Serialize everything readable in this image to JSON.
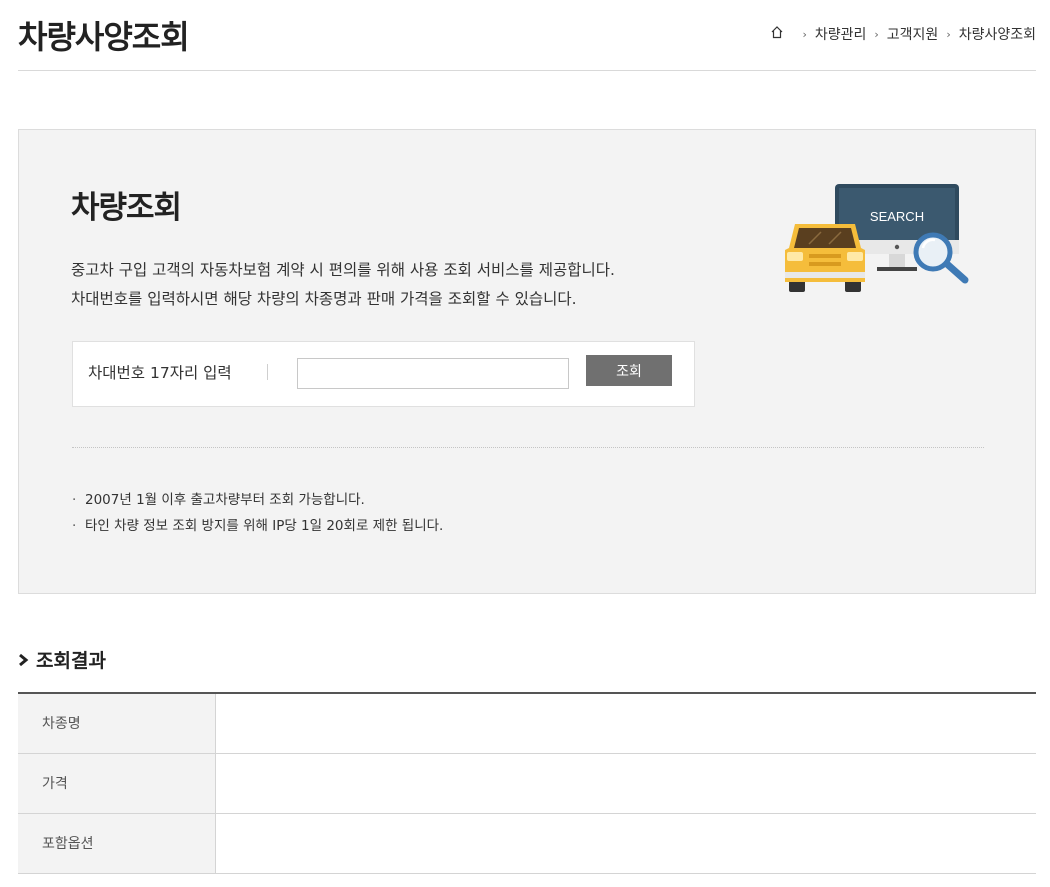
{
  "page": {
    "title": "차량사양조회"
  },
  "breadcrumb": {
    "home_icon": "home-icon",
    "items": [
      "차량관리",
      "고객지원",
      "차량사양조회"
    ]
  },
  "search_panel": {
    "title": "차량조회",
    "description": [
      "중고차 구입 고객의 자동차보험 계약 시 편의를 위해 사용 조회 서비스를 제공합니다.",
      "차대번호를 입력하시면 해당 차량의 차종명과 판매 가격을 조회할 수 있습니다."
    ],
    "illustration": {
      "monitor_text": "SEARCH",
      "icons": [
        "car-icon",
        "monitor-icon",
        "magnifier-icon"
      ]
    },
    "form": {
      "label": "차대번호 17자리 입력",
      "input_value": "",
      "input_placeholder": "",
      "button_label": "조회"
    },
    "notes": [
      "2007년 1월 이후 출고차량부터 조회 가능합니다.",
      "타인 차량 정보 조회 방지를 위해 IP당 1일 20회로 제한 됩니다."
    ]
  },
  "result": {
    "heading": "조회결과",
    "rows": [
      {
        "label": "차종명",
        "value": ""
      },
      {
        "label": "가격",
        "value": ""
      },
      {
        "label": "포함옵션",
        "value": ""
      }
    ]
  },
  "colors": {
    "panel_bg": "#f3f3f3",
    "button_bg": "#707070",
    "car_yellow": "#f5bd3b",
    "monitor_blue": "#2f4a5e",
    "magnifier_blue": "#3f7ab5"
  }
}
